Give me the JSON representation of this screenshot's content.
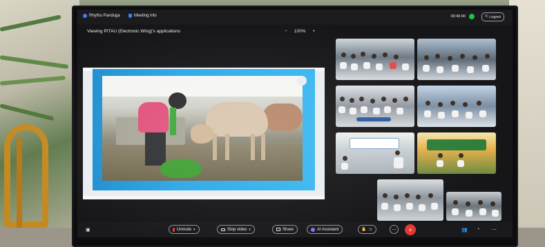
{
  "topbar": {
    "user_label": "Rhythu Panduga",
    "meeting_info_label": "Meeting info",
    "time": "00:40:00",
    "logout_label": "Logout"
  },
  "share_header": {
    "title": "Viewing PITAU (Electronic Wing)'s applications",
    "zoom_out": "−",
    "zoom_level": "100%",
    "zoom_in": "+"
  },
  "toolbar": {
    "unmute_label": "Unmute",
    "stop_video_label": "Stop video",
    "share_label": "Share",
    "ai_assistant_label": "AI Assistant",
    "end_icon": "×",
    "more_icon": "⋯"
  },
  "colors": {
    "brand_blue": "#3b82f6",
    "end_red": "#e53935",
    "status_green": "#1fbf4b"
  },
  "icons": [
    "user-dot-icon",
    "shield-icon",
    "status-dot-icon",
    "logout-icon",
    "mic-icon",
    "camera-icon",
    "share-icon",
    "ai-icon",
    "end-call-icon",
    "more-icon"
  ]
}
